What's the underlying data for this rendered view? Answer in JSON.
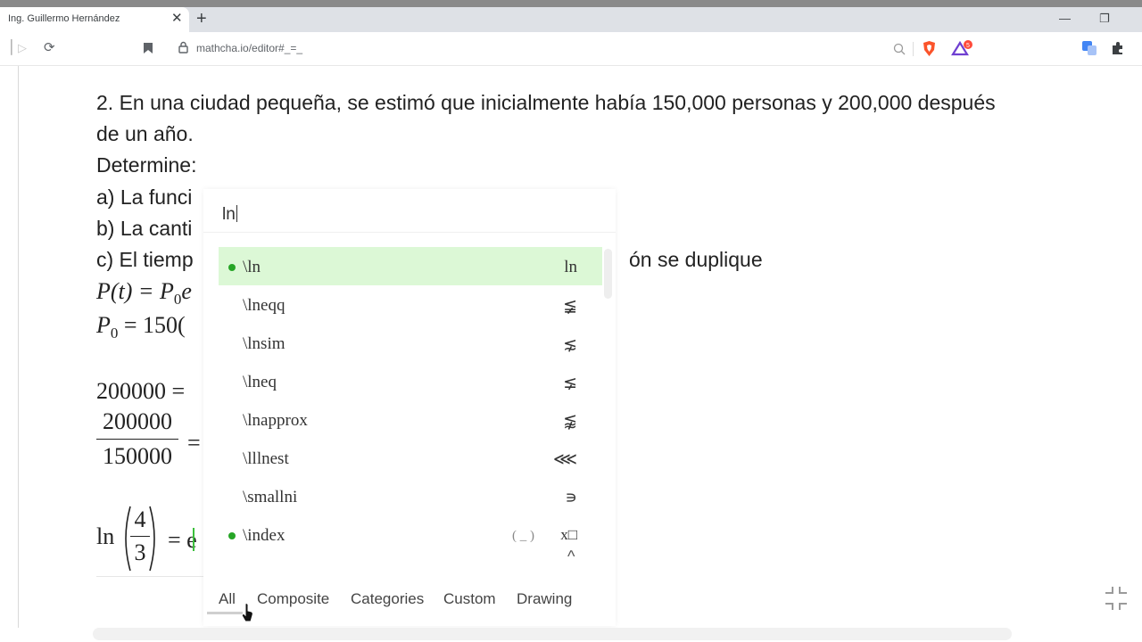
{
  "browser": {
    "tab_title": "Ing. Guillermo Hernández",
    "tab_close": "✕",
    "new_tab": "+",
    "url": "mathcha.io/editor#_=_",
    "minimize": "—",
    "restore": "❐"
  },
  "document": {
    "line1": "2. En una ciudad pequeña, se estimó que inicialmente había 150,000 personas y 200,000 después",
    "line2": "de un año.",
    "line3": "Determine:",
    "line4a": "a) La funci",
    "line4b": "b) La canti",
    "line4c": "c) El tiemp",
    "line4c_tail": "ón se duplique",
    "eq1": "P(t) = P",
    "eq1_sub": "0",
    "eq1_tail": "e",
    "eq2": "P",
    "eq2_sub": "0",
    "eq2_tail": " = 150(",
    "eq3": "200000 =",
    "frac_num": "200000",
    "frac_den": "150000",
    "frac_eq": "=",
    "ln_text": "ln",
    "ln_num": "4",
    "ln_den": "3",
    "ln_eq": "= e"
  },
  "autocomplete": {
    "query": "ln",
    "items": [
      {
        "cmd": "\\ln",
        "sym": "ln",
        "dot": true,
        "selected": true
      },
      {
        "cmd": "\\lneqq",
        "sym": "≨",
        "dot": false,
        "selected": false
      },
      {
        "cmd": "\\lnsim",
        "sym": "⋦",
        "dot": false,
        "selected": false
      },
      {
        "cmd": "\\lneq",
        "sym": "⪇",
        "dot": false,
        "selected": false
      },
      {
        "cmd": "\\lnapprox",
        "sym": "⪉",
        "dot": false,
        "selected": false
      },
      {
        "cmd": "\\lllnest",
        "sym": "⋘",
        "dot": false,
        "selected": false
      },
      {
        "cmd": "\\smallni",
        "sym": "∍",
        "dot": false,
        "selected": false
      },
      {
        "cmd": "\\index",
        "sym": "x□",
        "sym_extra": "( _ )",
        "dot": true,
        "selected": false
      }
    ],
    "more_indicator": "^",
    "tabs": [
      "All",
      "Composite",
      "Categories",
      "Custom",
      "Drawing"
    ],
    "active_tab": "All"
  }
}
